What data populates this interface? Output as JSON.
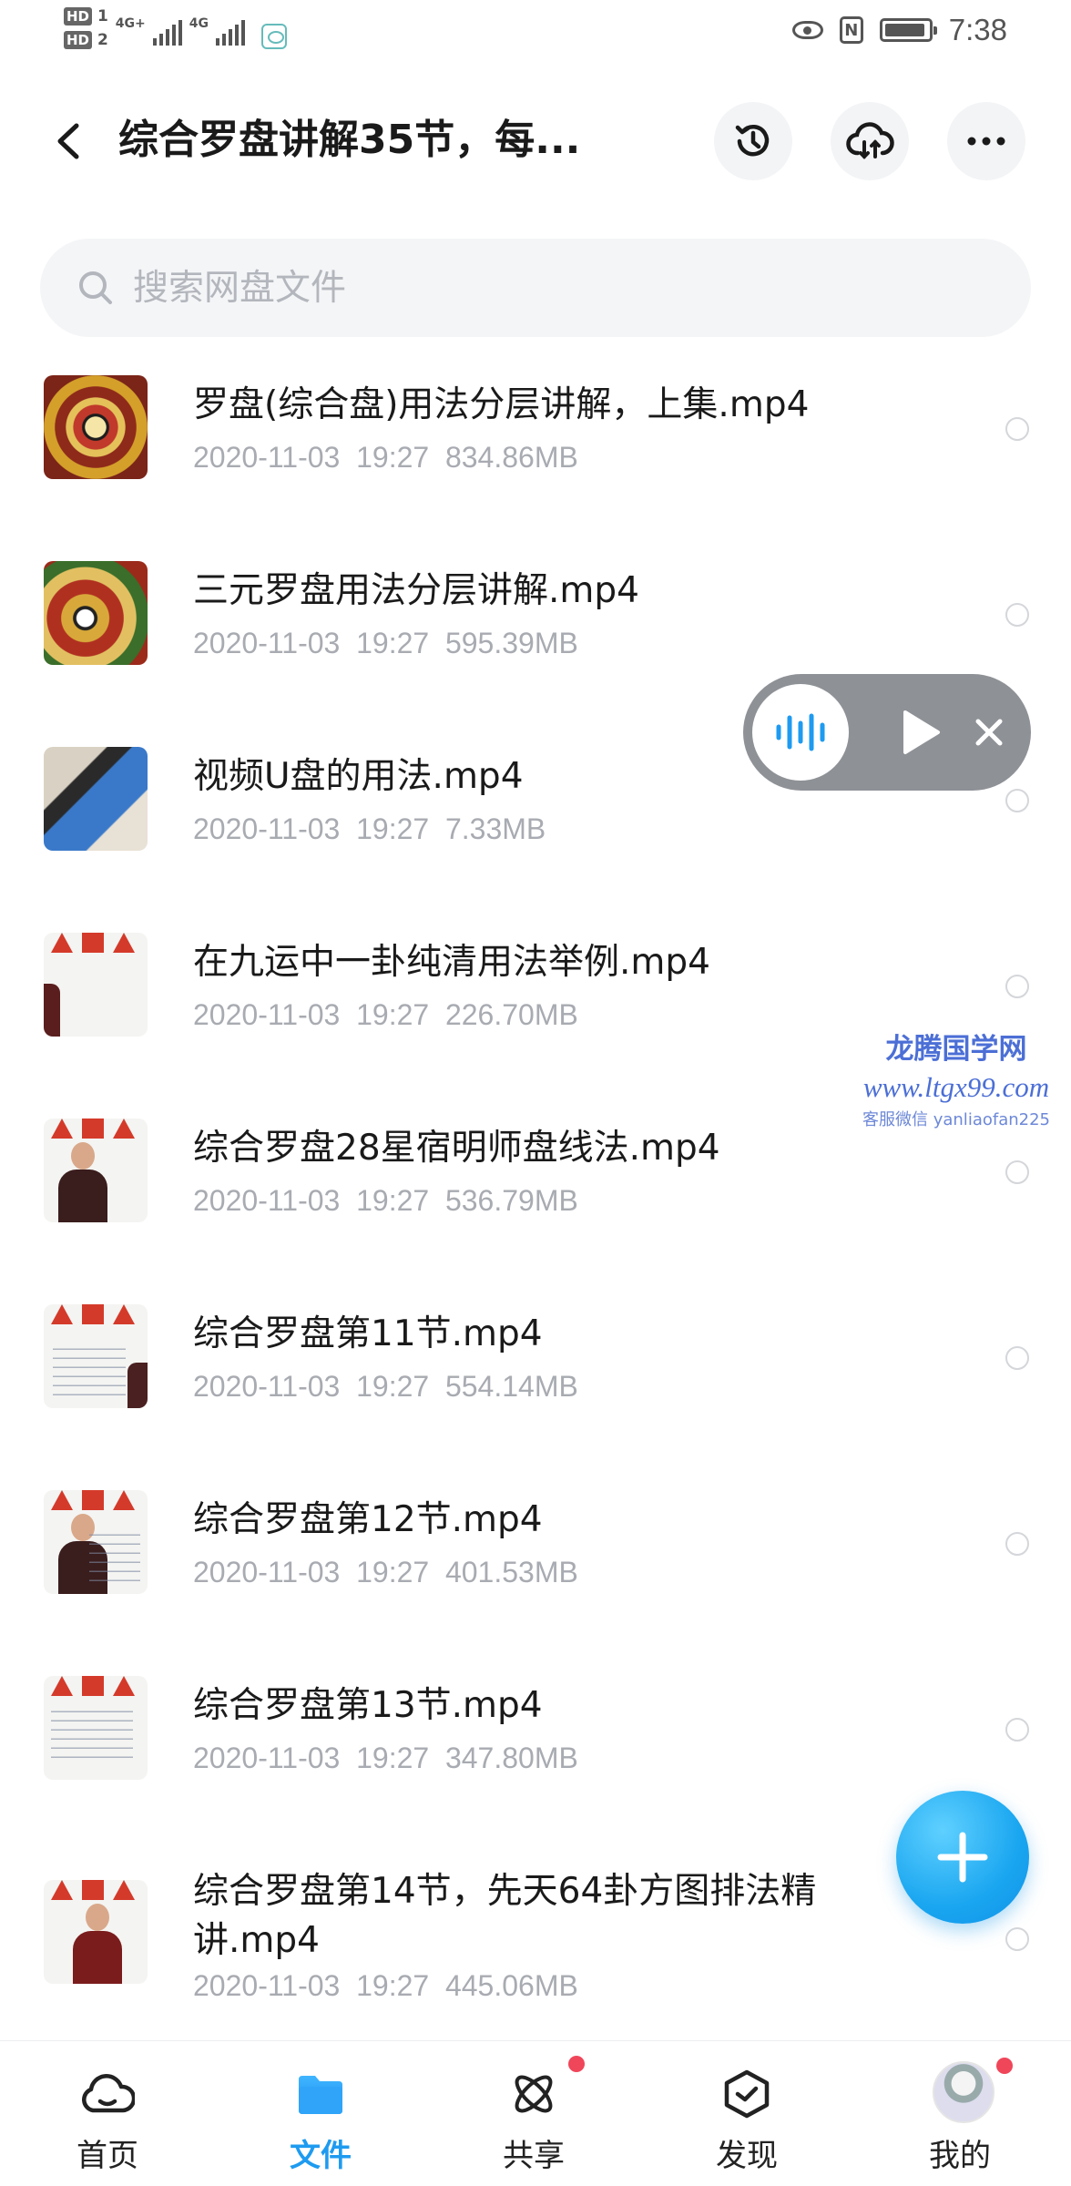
{
  "status_bar": {
    "hd1": "HD",
    "hd1_sub": "1",
    "hd2": "HD",
    "hd2_sub": "2",
    "net1": "4G+",
    "net2": "4G",
    "nfc": "N",
    "battery_level": 0.95,
    "time": "7:38"
  },
  "header": {
    "title": "综合罗盘讲解35节，每...",
    "icons": [
      "back-icon",
      "history-icon",
      "cloud-sync-icon",
      "more-icon"
    ]
  },
  "search": {
    "placeholder": "搜索网盘文件",
    "value": ""
  },
  "files": [
    {
      "name": "罗盘(综合盘)用法分层讲解，上集.mp4",
      "date": "2020-11-03",
      "time": "19:27",
      "size": "834.86MB"
    },
    {
      "name": "三元罗盘用法分层讲解.mp4",
      "date": "2020-11-03",
      "time": "19:27",
      "size": "595.39MB"
    },
    {
      "name": "视频U盘的用法.mp4",
      "date": "2020-11-03",
      "time": "19:27",
      "size": "7.33MB"
    },
    {
      "name": "在九运中一卦纯清用法举例.mp4",
      "date": "2020-11-03",
      "time": "19:27",
      "size": "226.70MB"
    },
    {
      "name": "综合罗盘28星宿明师盘线法.mp4",
      "date": "2020-11-03",
      "time": "19:27",
      "size": "536.79MB"
    },
    {
      "name": "综合罗盘第11节.mp4",
      "date": "2020-11-03",
      "time": "19:27",
      "size": "554.14MB"
    },
    {
      "name": "综合罗盘第12节.mp4",
      "date": "2020-11-03",
      "time": "19:27",
      "size": "401.53MB"
    },
    {
      "name": "综合罗盘第13节.mp4",
      "date": "2020-11-03",
      "time": "19:27",
      "size": "347.80MB"
    },
    {
      "name": "综合罗盘第14节，先天64卦方图排法精讲.mp4",
      "date": "2020-11-03",
      "time": "19:27",
      "size": "445.06MB"
    }
  ],
  "watermark": {
    "name": "龙腾国学网",
    "url": "www.ltgx99.com",
    "contact": "客服微信 yanliaofan225"
  },
  "bottom_nav": [
    {
      "label": "首页",
      "icon": "cloud-home-icon",
      "active": false
    },
    {
      "label": "文件",
      "icon": "folder-icon",
      "active": true
    },
    {
      "label": "共享",
      "icon": "share-atom-icon",
      "active": false,
      "badge": true
    },
    {
      "label": "发现",
      "icon": "discover-box-icon",
      "active": false
    },
    {
      "label": "我的",
      "icon": "avatar",
      "active": false,
      "badge": true
    }
  ],
  "colors": {
    "accent": "#1e9bf0",
    "badge": "#f0465a",
    "meta_text": "#a8abb1",
    "watermark": "#4c6fd6"
  }
}
